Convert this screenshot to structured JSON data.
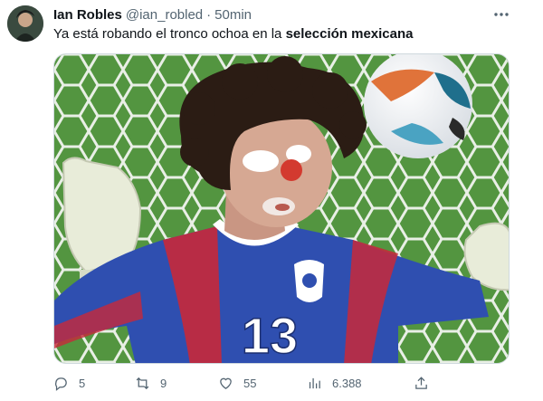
{
  "author": {
    "name": "Ian Robles",
    "handle": "@ian_robled",
    "separator": "·",
    "time": "50min"
  },
  "tweet": {
    "text_plain": "Ya está robando el tronco ochoa en la ",
    "text_bold": "selección mexicana"
  },
  "media": {
    "shirt_number": "13"
  },
  "actions": {
    "replies": "5",
    "reposts": "9",
    "likes": "55",
    "views": "6.388"
  },
  "icons": {
    "more": "more-dots-icon",
    "reply": "reply-icon",
    "repost": "repost-icon",
    "like": "heart-icon",
    "views": "views-chart-icon",
    "share": "share-icon"
  },
  "colors": {
    "text": "#0f1419",
    "secondary": "#536471",
    "border": "#cfd9de",
    "jersey_blue": "#2f4fb0",
    "jersey_red": "#c8283a",
    "pitch_green": "#4d8f3c"
  }
}
